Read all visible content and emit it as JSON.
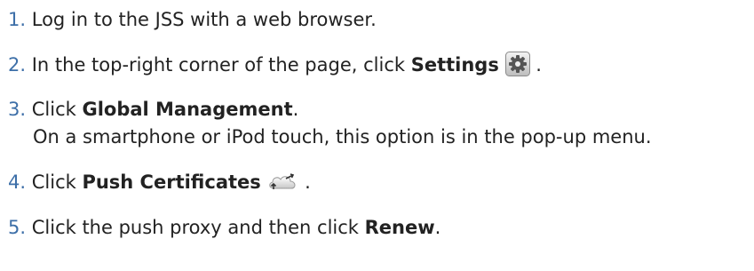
{
  "steps": [
    {
      "number": "1.",
      "parts": [
        "Log in to the JSS with a web browser."
      ]
    },
    {
      "number": "2.",
      "parts": [
        "In the top-right corner of the page, click ",
        "Settings",
        " ."
      ],
      "icon": "gear-icon"
    },
    {
      "number": "3.",
      "parts": [
        "Click ",
        "Global Management",
        "."
      ],
      "note": "On a smartphone or iPod touch, this option is in the pop-up menu."
    },
    {
      "number": "4.",
      "parts": [
        "Click ",
        "Push Certificates",
        " ."
      ],
      "icon": "cloud-icon"
    },
    {
      "number": "5.",
      "parts": [
        "Click the push proxy and then click ",
        "Renew",
        "."
      ]
    }
  ]
}
